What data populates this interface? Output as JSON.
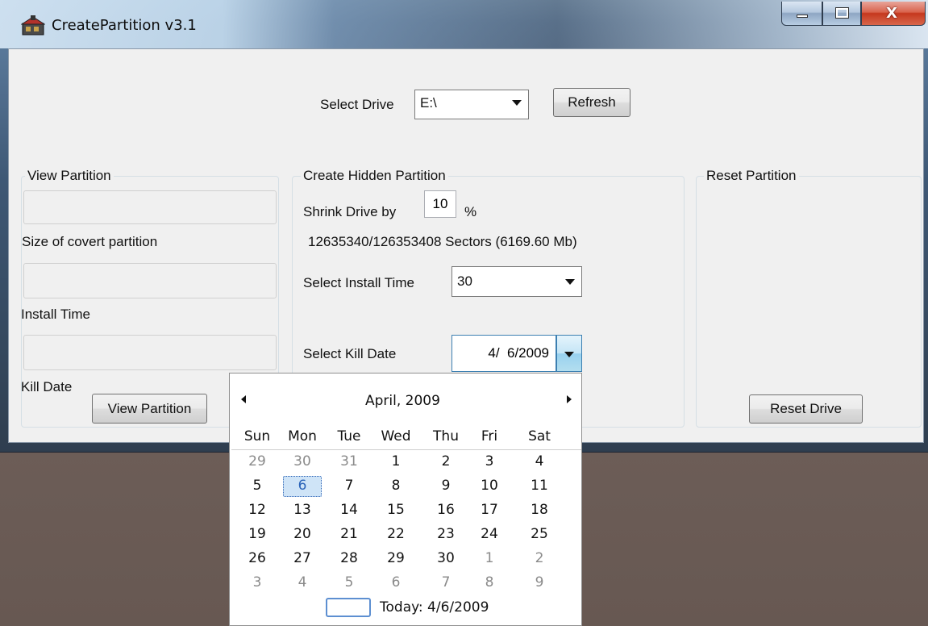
{
  "window": {
    "title": "CreatePartition v3.1",
    "icon": "partition-app-icon",
    "controls": [
      "minimize-icon",
      "maximize-icon",
      "close-icon"
    ]
  },
  "drive": {
    "label": "Select Drive",
    "value": "E:\\",
    "refresh_label": "Refresh"
  },
  "view_partition": {
    "group_title": "View Partition",
    "size_label": "Size of covert partition",
    "install_label": "Install Time",
    "kill_label": "Kill Date",
    "button_label": "View Partition"
  },
  "create_hidden": {
    "group_title": "Create Hidden Partition",
    "shrink_label": "Shrink Drive by",
    "shrink_value": "10",
    "shrink_unit": "%",
    "sectors_text": "12635340/126353408 Sectors (6169.60 Mb)",
    "install_label": "Select Install Time",
    "install_value": "30",
    "kill_label": "Select Kill Date",
    "kill_value": "4/  6/2009"
  },
  "reset": {
    "group_title": "Reset Partition",
    "button_label": "Reset Drive"
  },
  "calendar": {
    "month_label": "April, 2009",
    "day_headers": [
      "Sun",
      "Mon",
      "Tue",
      "Wed",
      "Thu",
      "Fri",
      "Sat"
    ],
    "weeks": [
      [
        "29",
        "30",
        "31",
        "1",
        "2",
        "3",
        "4"
      ],
      [
        "5",
        "6",
        "7",
        "8",
        "9",
        "10",
        "11"
      ],
      [
        "12",
        "13",
        "14",
        "15",
        "16",
        "17",
        "18"
      ],
      [
        "19",
        "20",
        "21",
        "22",
        "23",
        "24",
        "25"
      ],
      [
        "26",
        "27",
        "28",
        "29",
        "30",
        "1",
        "2"
      ],
      [
        "3",
        "4",
        "5",
        "6",
        "7",
        "8",
        "9"
      ]
    ],
    "muted": [
      [
        true,
        true,
        true,
        false,
        false,
        false,
        false
      ],
      [
        false,
        false,
        false,
        false,
        false,
        false,
        false
      ],
      [
        false,
        false,
        false,
        false,
        false,
        false,
        false
      ],
      [
        false,
        false,
        false,
        false,
        false,
        false,
        false
      ],
      [
        false,
        false,
        false,
        false,
        false,
        true,
        true
      ],
      [
        true,
        true,
        true,
        true,
        true,
        true,
        true
      ]
    ],
    "selected_day": "6",
    "today_label": "Today: 4/6/2009",
    "colors": {
      "selected_text": "#2a63b8",
      "muted_text": "#8a8a8a"
    }
  }
}
